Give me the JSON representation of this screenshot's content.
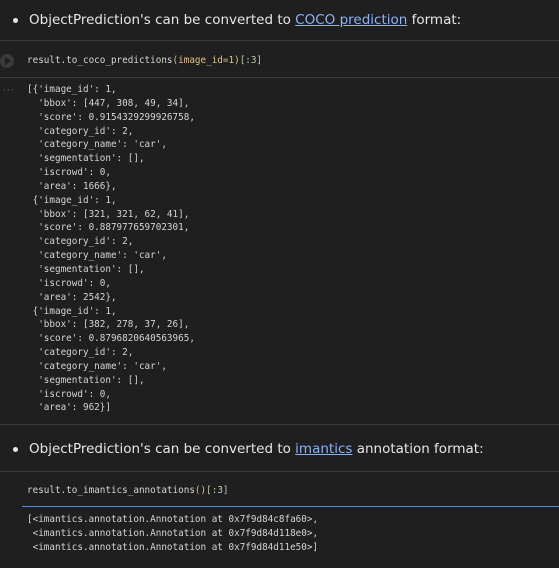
{
  "md1": {
    "before": "ObjectPrediction's can be converted to ",
    "link": "COCO prediction",
    "after": " format:"
  },
  "cell1": {
    "code_prefix": "result.to_coco_predictions",
    "code_args": "(image_id=1)",
    "code_slice": "[:3]"
  },
  "output1": {
    "lines": [
      "[{'image_id': 1,",
      "  'bbox': [447, 308, 49, 34],",
      "  'score': 0.9154329299926758,",
      "  'category_id': 2,",
      "  'category_name': 'car',",
      "  'segmentation': [],",
      "  'iscrowd': 0,",
      "  'area': 1666},",
      " {'image_id': 1,",
      "  'bbox': [321, 321, 62, 41],",
      "  'score': 0.887977659702301,",
      "  'category_id': 2,",
      "  'category_name': 'car',",
      "  'segmentation': [],",
      "  'iscrowd': 0,",
      "  'area': 2542},",
      " {'image_id': 1,",
      "  'bbox': [382, 278, 37, 26],",
      "  'score': 0.8796820640563965,",
      "  'category_id': 2,",
      "  'category_name': 'car',",
      "  'segmentation': [],",
      "  'iscrowd': 0,",
      "  'area': 962}]"
    ]
  },
  "md2": {
    "before": "ObjectPrediction's can be converted to ",
    "link": "imantics",
    "after": " annotation format:"
  },
  "cell2": {
    "code_prefix": "result.to_imantics_annotations",
    "code_args": "()",
    "code_slice": "[:3]"
  },
  "output2": {
    "lines": [
      "[<imantics.annotation.Annotation at 0x7f9d84c8fa60>,",
      " <imantics.annotation.Annotation at 0x7f9d84d118e0>,",
      " <imantics.annotation.Annotation at 0x7f9d84d11e50>]"
    ]
  },
  "icons": {
    "run": "play-icon",
    "output": "more-dots-icon"
  },
  "colors": {
    "background": "#1f1f1f",
    "text": "#e6e6e6",
    "link": "#8ab4f8",
    "divider": "#3c3c3c",
    "focus": "#4a90e2"
  }
}
